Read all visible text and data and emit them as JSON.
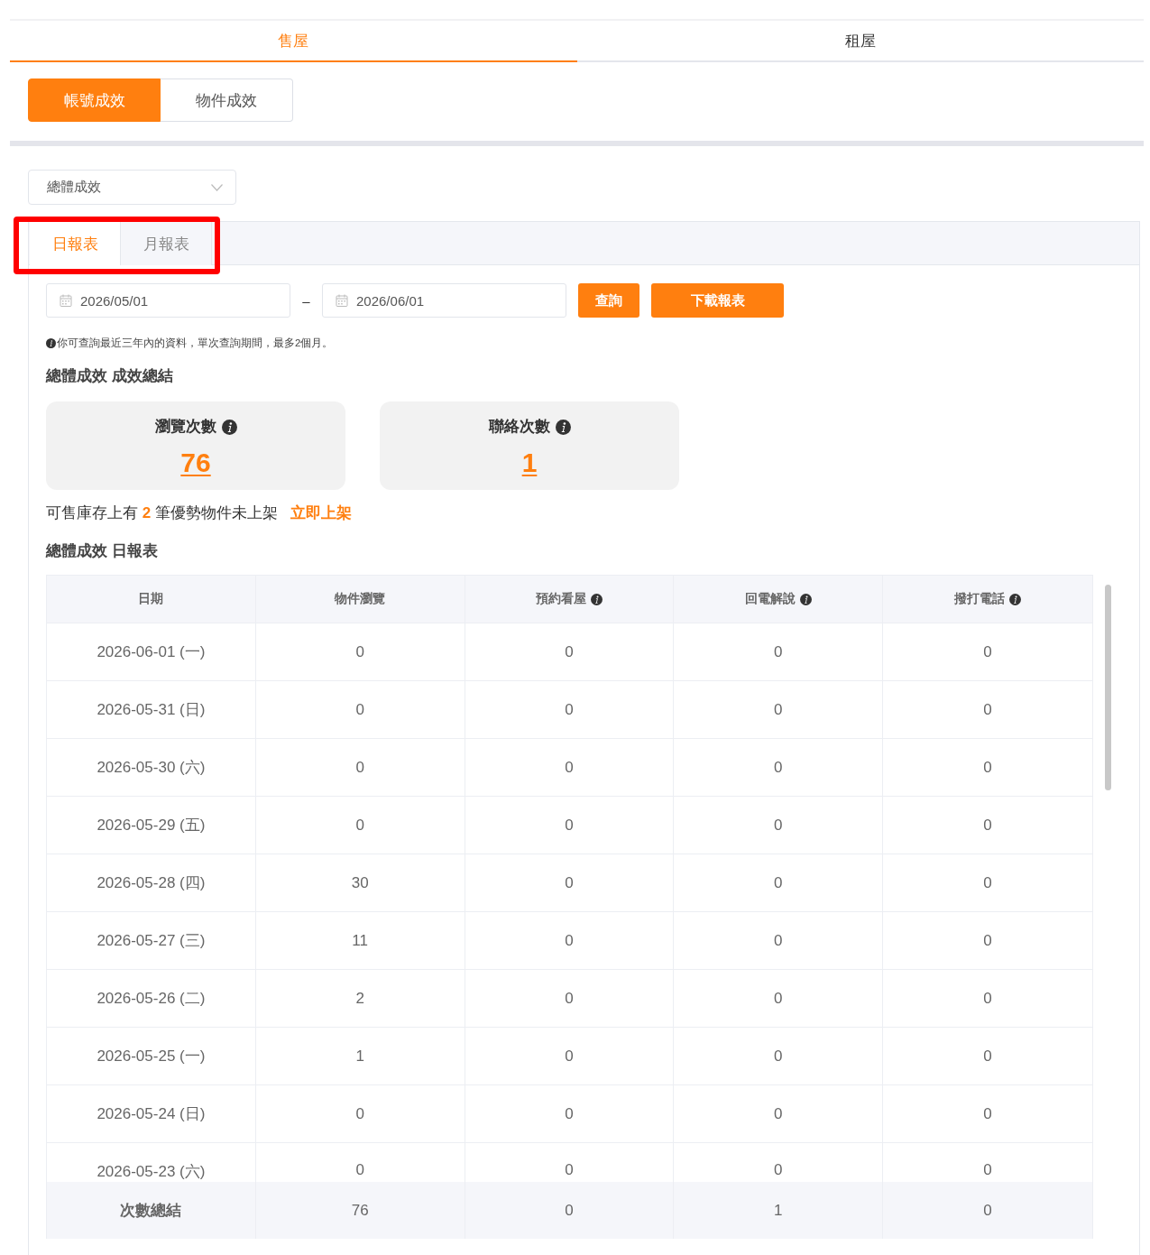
{
  "top_tabs": [
    {
      "label": "售屋",
      "selected": true
    },
    {
      "label": "租屋",
      "selected": false
    }
  ],
  "segments": [
    {
      "label": "帳號成效",
      "selected": true
    },
    {
      "label": "物件成效",
      "selected": false
    }
  ],
  "scope_select": {
    "value": "總體成效"
  },
  "report_tabs": {
    "highlighted": true,
    "tabs": [
      {
        "label": "日報表",
        "selected": true
      },
      {
        "label": "月報表",
        "selected": false
      }
    ]
  },
  "date_range": {
    "start": "2026/05/01",
    "separator": "–",
    "end": "2026/06/01"
  },
  "buttons": [
    {
      "label": "查詢",
      "kind": "query"
    },
    {
      "label": "下載報表",
      "kind": "download"
    }
  ],
  "note": "你可查詢最近三年內的資料，單次查詢期間，最多2個月。",
  "summary_heading": "總體成效 成效總結",
  "stat_cards": [
    {
      "title": "瀏覽次數",
      "value": "76"
    },
    {
      "title": "聯絡次數",
      "value": "1"
    }
  ],
  "inventory_notice": {
    "text": "可售庫存上有 **2** 筆優勢物件未上架",
    "link": "立即上架"
  },
  "table_heading": "總體成效 日報表",
  "table": {
    "columns": [
      {
        "label": "日期",
        "info": false
      },
      {
        "label": "物件瀏覽",
        "info": false
      },
      {
        "label": "預約看屋",
        "info": true
      },
      {
        "label": "回電解說",
        "info": true
      },
      {
        "label": "撥打電話",
        "info": true
      }
    ],
    "rows": [
      [
        "2026-06-01 (一)",
        "0",
        "0",
        "0",
        "0"
      ],
      [
        "2026-05-31 (日)",
        "0",
        "0",
        "0",
        "0"
      ],
      [
        "2026-05-30 (六)",
        "0",
        "0",
        "0",
        "0"
      ],
      [
        "2026-05-29 (五)",
        "0",
        "0",
        "0",
        "0"
      ],
      [
        "2026-05-28 (四)",
        "30",
        "0",
        "0",
        "0"
      ],
      [
        "2026-05-27 (三)",
        "11",
        "0",
        "0",
        "0"
      ],
      [
        "2026-05-26 (二)",
        "2",
        "0",
        "0",
        "0"
      ],
      [
        "2026-05-25 (一)",
        "1",
        "0",
        "0",
        "0"
      ],
      [
        "2026-05-24 (日)",
        "0",
        "0",
        "0",
        "0"
      ],
      [
        "2026-05-23 (六)",
        "0",
        "0",
        "0",
        "0"
      ]
    ],
    "totals": [
      "次數總結",
      "76",
      "0",
      "1",
      "0"
    ]
  }
}
